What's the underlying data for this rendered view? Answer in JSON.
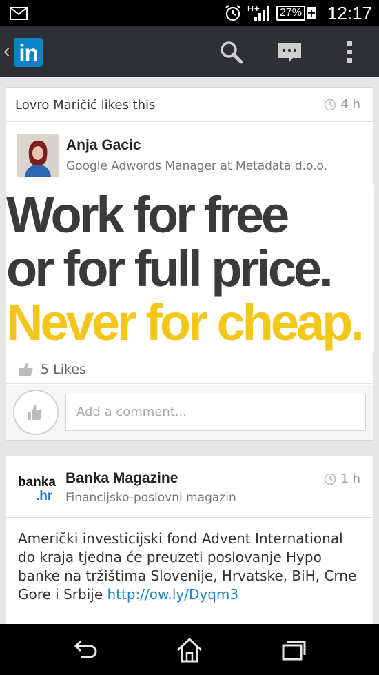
{
  "status_bar": {
    "network": "H+",
    "battery": "27%",
    "battery_plus": "+",
    "time": "12:17"
  },
  "action_bar": {
    "back_glyph": "‹",
    "logo_text": "in",
    "icons": [
      "search-icon",
      "messages-icon",
      "overflow-menu-icon"
    ]
  },
  "posts": [
    {
      "activity": "Lovro Maričić likes this",
      "time": "4 h",
      "author_name": "Anja Gacic",
      "author_headline": "Google Adwords Manager at Metadata d.o.o.",
      "quote_lines": [
        "Work for free",
        "or for full price.",
        "Never for cheap."
      ],
      "likes": "5 Likes",
      "comment_placeholder": "Add a comment..."
    },
    {
      "company_logo_top": "banka",
      "company_logo_bottom": ".hr",
      "author_name": "Banka Magazine",
      "author_headline": "Financijsko-poslovni magazin",
      "time": "1 h",
      "body": "Američki investicijski fond Advent International do kraja tjedna će preuzeti poslovanje Hypo banke na tržištima Slovenije, Hrvatske, BiH, Crne Gore i Srbije ",
      "link": "http://ow.ly/Dyqm3"
    }
  ],
  "colors": {
    "linkedin_blue": "#0a84c6",
    "action_bar": "#2e3033",
    "quote_dark": "#3a3a3a",
    "quote_yellow": "#f3c61a",
    "link": "#1b86c6"
  }
}
